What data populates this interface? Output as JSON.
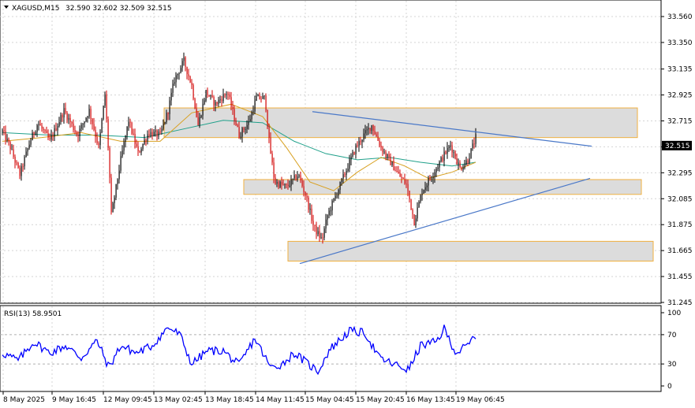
{
  "header": {
    "symbol": "XAGUSD,M15",
    "ohlc": "32.590 32.602 32.509 32.515"
  },
  "chart_data": [
    {
      "type": "candlestick",
      "symbol": "XAGUSD",
      "timeframe": "M15",
      "ylim": [
        31.245,
        33.56
      ],
      "y_ticks": [
        "33.560",
        "33.350",
        "33.135",
        "32.925",
        "32.715",
        "32.505",
        "32.295",
        "32.085",
        "31.875",
        "31.665",
        "31.455",
        "31.245"
      ],
      "last_price": "32.515",
      "price_anchors": [
        {
          "x": 0,
          "y": 32.63
        },
        {
          "x": 10,
          "y": 32.5
        },
        {
          "x": 22,
          "y": 32.28
        },
        {
          "x": 35,
          "y": 32.55
        },
        {
          "x": 45,
          "y": 32.7
        },
        {
          "x": 60,
          "y": 32.55
        },
        {
          "x": 78,
          "y": 32.8
        },
        {
          "x": 95,
          "y": 32.6
        },
        {
          "x": 110,
          "y": 32.8
        },
        {
          "x": 122,
          "y": 32.5
        },
        {
          "x": 130,
          "y": 32.93
        },
        {
          "x": 135,
          "y": 32.4
        },
        {
          "x": 138,
          "y": 31.95
        },
        {
          "x": 150,
          "y": 32.4
        },
        {
          "x": 160,
          "y": 32.72
        },
        {
          "x": 172,
          "y": 32.45
        },
        {
          "x": 185,
          "y": 32.62
        },
        {
          "x": 200,
          "y": 32.6
        },
        {
          "x": 210,
          "y": 32.8
        },
        {
          "x": 218,
          "y": 33.05
        },
        {
          "x": 230,
          "y": 33.2
        },
        {
          "x": 240,
          "y": 33.0
        },
        {
          "x": 248,
          "y": 32.68
        },
        {
          "x": 258,
          "y": 32.95
        },
        {
          "x": 270,
          "y": 32.85
        },
        {
          "x": 285,
          "y": 32.95
        },
        {
          "x": 300,
          "y": 32.6
        },
        {
          "x": 312,
          "y": 32.7
        },
        {
          "x": 322,
          "y": 32.9
        },
        {
          "x": 333,
          "y": 32.9
        },
        {
          "x": 338,
          "y": 32.55
        },
        {
          "x": 345,
          "y": 32.22
        },
        {
          "x": 360,
          "y": 32.18
        },
        {
          "x": 375,
          "y": 32.28
        },
        {
          "x": 385,
          "y": 32.1
        },
        {
          "x": 395,
          "y": 31.85
        },
        {
          "x": 405,
          "y": 31.75
        },
        {
          "x": 412,
          "y": 31.95
        },
        {
          "x": 425,
          "y": 32.15
        },
        {
          "x": 438,
          "y": 32.35
        },
        {
          "x": 448,
          "y": 32.5
        },
        {
          "x": 458,
          "y": 32.6
        },
        {
          "x": 468,
          "y": 32.68
        },
        {
          "x": 480,
          "y": 32.5
        },
        {
          "x": 490,
          "y": 32.4
        },
        {
          "x": 502,
          "y": 32.28
        },
        {
          "x": 512,
          "y": 32.2
        },
        {
          "x": 522,
          "y": 31.9
        },
        {
          "x": 532,
          "y": 32.15
        },
        {
          "x": 545,
          "y": 32.28
        },
        {
          "x": 558,
          "y": 32.42
        },
        {
          "x": 568,
          "y": 32.52
        },
        {
          "x": 580,
          "y": 32.33
        },
        {
          "x": 590,
          "y": 32.4
        },
        {
          "x": 600,
          "y": 32.58
        }
      ],
      "ma_fast": [
        {
          "x": 0,
          "y": 32.55
        },
        {
          "x": 50,
          "y": 32.58
        },
        {
          "x": 100,
          "y": 32.62
        },
        {
          "x": 150,
          "y": 32.55
        },
        {
          "x": 200,
          "y": 32.55
        },
        {
          "x": 240,
          "y": 32.78
        },
        {
          "x": 290,
          "y": 32.85
        },
        {
          "x": 330,
          "y": 32.75
        },
        {
          "x": 360,
          "y": 32.5
        },
        {
          "x": 390,
          "y": 32.22
        },
        {
          "x": 420,
          "y": 32.15
        },
        {
          "x": 450,
          "y": 32.3
        },
        {
          "x": 480,
          "y": 32.42
        },
        {
          "x": 510,
          "y": 32.35
        },
        {
          "x": 540,
          "y": 32.25
        },
        {
          "x": 570,
          "y": 32.3
        },
        {
          "x": 600,
          "y": 32.38
        }
      ],
      "ma_slow": [
        {
          "x": 0,
          "y": 32.62
        },
        {
          "x": 60,
          "y": 32.6
        },
        {
          "x": 120,
          "y": 32.6
        },
        {
          "x": 180,
          "y": 32.58
        },
        {
          "x": 230,
          "y": 32.65
        },
        {
          "x": 280,
          "y": 32.72
        },
        {
          "x": 330,
          "y": 32.7
        },
        {
          "x": 370,
          "y": 32.55
        },
        {
          "x": 410,
          "y": 32.45
        },
        {
          "x": 450,
          "y": 32.4
        },
        {
          "x": 490,
          "y": 32.42
        },
        {
          "x": 530,
          "y": 32.38
        },
        {
          "x": 570,
          "y": 32.35
        },
        {
          "x": 600,
          "y": 32.38
        }
      ],
      "zones": [
        {
          "x0": 208,
          "x1": 808,
          "y0": 32.82,
          "y1": 32.58
        },
        {
          "x0": 309,
          "x1": 813,
          "y0": 32.24,
          "y1": 32.12
        },
        {
          "x0": 365,
          "x1": 828,
          "y0": 31.74,
          "y1": 31.58
        }
      ],
      "trendlines": [
        {
          "x0": 396,
          "y0": 32.79,
          "x1": 750,
          "y1": 32.51
        },
        {
          "x0": 380,
          "y0": 31.56,
          "x1": 748,
          "y1": 32.25
        }
      ]
    },
    {
      "type": "line",
      "indicator": "RSI(13) 58.9501",
      "ylim": [
        0,
        100
      ],
      "y_ticks": [
        "100",
        "70",
        "30",
        "0"
      ],
      "levels": [
        70,
        30
      ],
      "rsi_anchors": [
        {
          "x": 0,
          "y": 45
        },
        {
          "x": 20,
          "y": 35
        },
        {
          "x": 40,
          "y": 60
        },
        {
          "x": 60,
          "y": 45
        },
        {
          "x": 80,
          "y": 55
        },
        {
          "x": 100,
          "y": 38
        },
        {
          "x": 120,
          "y": 62
        },
        {
          "x": 135,
          "y": 25
        },
        {
          "x": 150,
          "y": 55
        },
        {
          "x": 170,
          "y": 45
        },
        {
          "x": 190,
          "y": 55
        },
        {
          "x": 210,
          "y": 80
        },
        {
          "x": 225,
          "y": 70
        },
        {
          "x": 240,
          "y": 30
        },
        {
          "x": 260,
          "y": 48
        },
        {
          "x": 280,
          "y": 48
        },
        {
          "x": 300,
          "y": 28
        },
        {
          "x": 320,
          "y": 65
        },
        {
          "x": 340,
          "y": 25
        },
        {
          "x": 355,
          "y": 30
        },
        {
          "x": 370,
          "y": 45
        },
        {
          "x": 385,
          "y": 32
        },
        {
          "x": 400,
          "y": 20
        },
        {
          "x": 415,
          "y": 50
        },
        {
          "x": 440,
          "y": 75
        },
        {
          "x": 460,
          "y": 72
        },
        {
          "x": 478,
          "y": 38
        },
        {
          "x": 495,
          "y": 30
        },
        {
          "x": 515,
          "y": 22
        },
        {
          "x": 530,
          "y": 55
        },
        {
          "x": 550,
          "y": 60
        },
        {
          "x": 560,
          "y": 78
        },
        {
          "x": 575,
          "y": 45
        },
        {
          "x": 590,
          "y": 55
        },
        {
          "x": 600,
          "y": 70
        }
      ]
    }
  ],
  "x_labels": [
    "8 May 2025",
    "9 May 16:45",
    "12 May 09:45",
    "13 May 02:45",
    "13 May 18:45",
    "14 May 11:45",
    "15 May 04:45",
    "15 May 20:45",
    "16 May 13:45",
    "19 May 06:45"
  ],
  "colors": {
    "candle_up": "#000000",
    "candle_down": "#d10000",
    "ma_fast": "#d8a020",
    "ma_slow": "#1fa08a",
    "zone_fill": "#dcdcdc",
    "zone_border": "#f0b040",
    "trendline": "#4a78c8",
    "rsi": "#0000ff",
    "grid": "#d4d4d4",
    "price_tag_bg": "#000000",
    "price_tag_fg": "#ffffff"
  }
}
